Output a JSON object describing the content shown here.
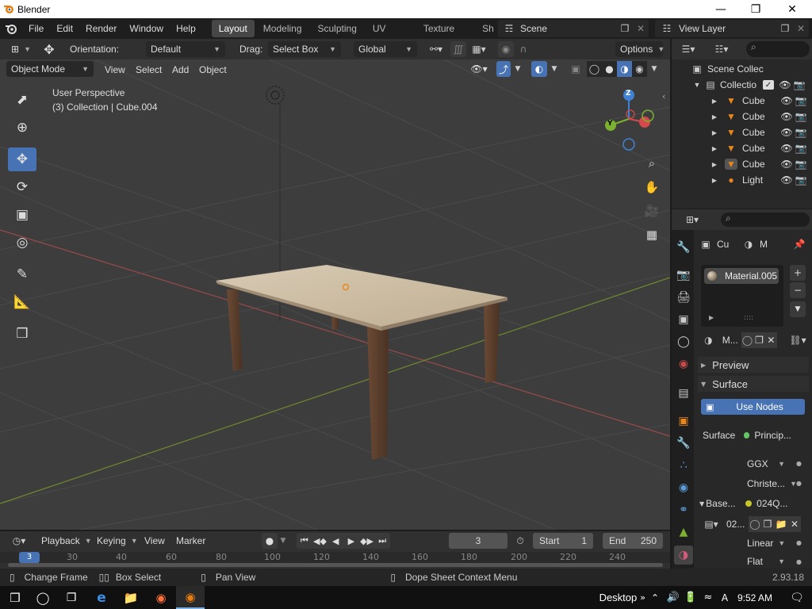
{
  "window": {
    "title": "Blender"
  },
  "menu": [
    "File",
    "Edit",
    "Render",
    "Window",
    "Help"
  ],
  "workspaces": [
    "Layout",
    "Modeling",
    "Sculpting",
    "UV Editing",
    "Texture Paint",
    "Sh"
  ],
  "scene": {
    "name": "Scene",
    "view_layer": "View Layer"
  },
  "tool_header": {
    "orientation_label": "Orientation:",
    "orientation_value": "Default",
    "drag_label": "Drag:",
    "drag_value": "Select Box",
    "transform_space": "Global",
    "options": "Options"
  },
  "viewport_header": {
    "mode": "Object Mode",
    "menus": [
      "View",
      "Select",
      "Add",
      "Object"
    ]
  },
  "viewport": {
    "perspective": "User Perspective",
    "collection_info": "(3) Collection | Cube.004"
  },
  "gizmo": {
    "z": "Z",
    "y": "Y"
  },
  "outliner": {
    "scene_collection": "Scene Collec",
    "collection": "Collectio",
    "items": [
      "Cube",
      "Cube",
      "Cube",
      "Cube",
      "Cube",
      "Light"
    ]
  },
  "properties": {
    "context_obj": "Cu",
    "context_mat": "M",
    "material_slot": "Material.005",
    "mat_name": "M...",
    "preview": "Preview",
    "surface_panel": "Surface",
    "use_nodes": "Use Nodes",
    "surface_label": "Surface",
    "surface_value": "Princip...",
    "distribution": "GGX",
    "subsurface": "Christe...",
    "base_color_label": "Base...",
    "base_color_value": "024Q...",
    "image_name": "02...",
    "interpolation": "Linear",
    "projection": "Flat"
  },
  "timeline": {
    "menus": [
      "Playback",
      "Keying",
      "View",
      "Marker"
    ],
    "current_frame": "3",
    "start_label": "Start",
    "start": "1",
    "end_label": "End",
    "end": "250",
    "ticks": [
      "30",
      "40",
      "60",
      "80",
      "100",
      "120",
      "140",
      "160",
      "180",
      "200",
      "220",
      "240"
    ],
    "current_tick": "3"
  },
  "status": {
    "change_frame": "Change Frame",
    "box_select": "Box Select",
    "pan_view": "Pan View",
    "context_menu": "Dope Sheet Context Menu",
    "version": "2.93.18"
  },
  "taskbar": {
    "desktop": "Desktop",
    "time": "9:52 AM"
  },
  "colors": {
    "accent": "#4772b3",
    "x_axis": "#d44a4a",
    "y_axis": "#7cb130",
    "z_axis": "#3f82d4"
  }
}
